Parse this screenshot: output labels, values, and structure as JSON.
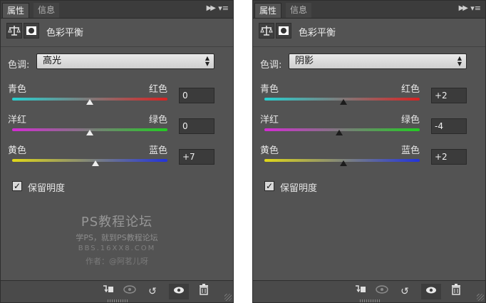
{
  "panels": [
    {
      "tabs": {
        "active": "属性",
        "inactive": "信息"
      },
      "title": "色彩平衡",
      "tone": {
        "label": "色调:",
        "value": "高光"
      },
      "sliders": [
        {
          "left": "青色",
          "right": "红色",
          "value": "0",
          "position": 0.5,
          "gradient": [
            "#27d1d1",
            "#d92222"
          ]
        },
        {
          "left": "洋红",
          "right": "绿色",
          "value": "0",
          "position": 0.5,
          "gradient": [
            "#d42bd4",
            "#22cc22"
          ]
        },
        {
          "left": "黄色",
          "right": "蓝色",
          "value": "+7",
          "position": 0.535,
          "gradient": [
            "#e0d818",
            "#2233dd"
          ]
        }
      ],
      "preserve_luminosity": {
        "label": "保留明度",
        "checked": true
      },
      "watermark": {
        "title": "PS教程论坛",
        "subtitle": "学PS，就到PS教程论坛",
        "url": "BBS.16XX8.COM",
        "author": "作者：@阿茗儿呀"
      }
    },
    {
      "tabs": {
        "active": "属性",
        "inactive": "信息"
      },
      "title": "色彩平衡",
      "tone": {
        "label": "色调:",
        "value": "阴影"
      },
      "sliders": [
        {
          "left": "青色",
          "right": "红色",
          "value": "+2",
          "position": 0.51,
          "gradient": [
            "#27d1d1",
            "#d92222"
          ]
        },
        {
          "left": "洋红",
          "right": "绿色",
          "value": "-4",
          "position": 0.48,
          "gradient": [
            "#d42bd4",
            "#22cc22"
          ]
        },
        {
          "left": "黄色",
          "right": "蓝色",
          "value": "+2",
          "position": 0.51,
          "gradient": [
            "#e0d818",
            "#2233dd"
          ]
        }
      ],
      "preserve_luminosity": {
        "label": "保留明度",
        "checked": true
      }
    }
  ],
  "icons": {
    "tab_close": "×",
    "collapse": "▶▶",
    "menu": "▾≡",
    "clip": "⤵",
    "view_previous": "👁",
    "reset": "↺",
    "visibility": "👁",
    "delete": "🗑"
  }
}
